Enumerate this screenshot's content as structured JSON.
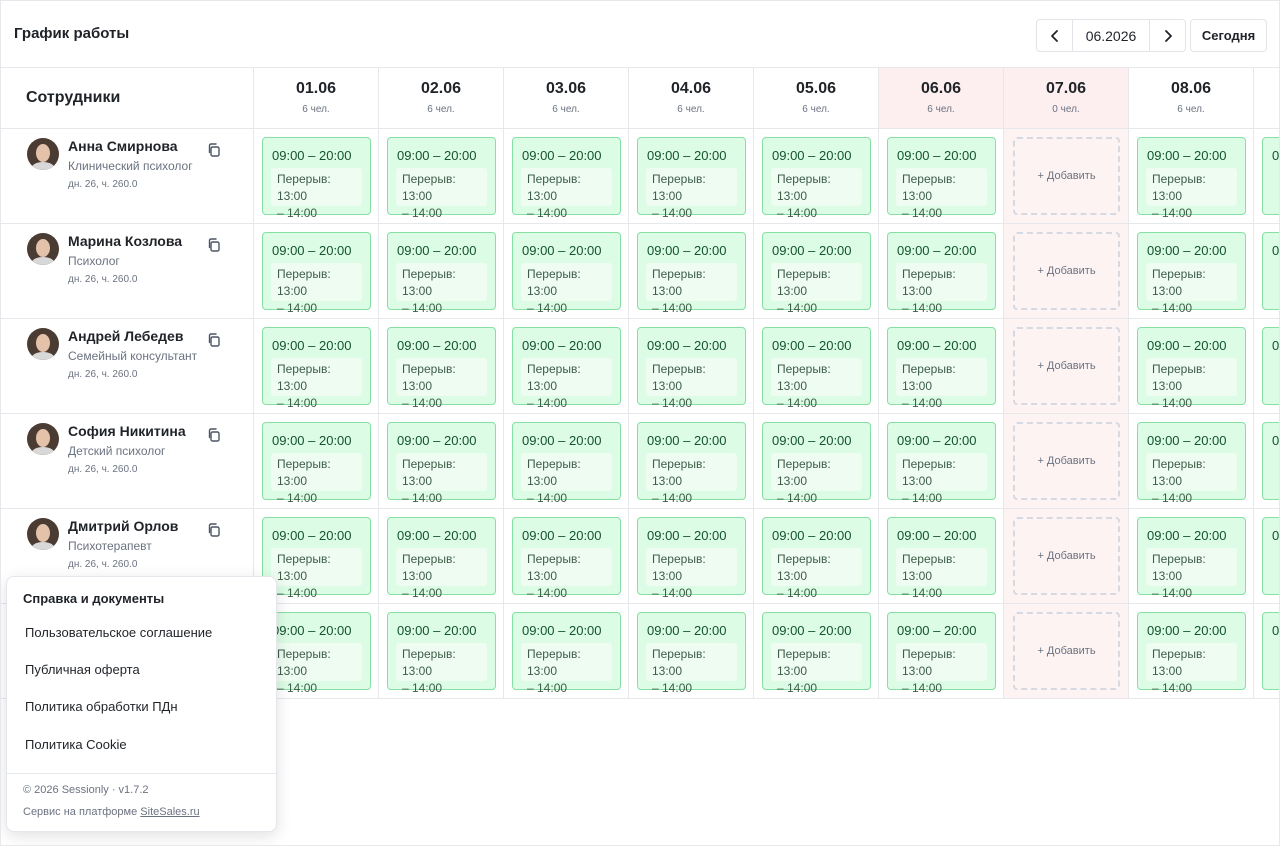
{
  "header": {
    "title": "График работы",
    "month": "06.2026",
    "today_label": "Сегодня"
  },
  "grid": {
    "employees_header": "Сотрудники",
    "days": [
      {
        "date": "01.06",
        "count": "6 чел.",
        "highlight": false
      },
      {
        "date": "02.06",
        "count": "6 чел.",
        "highlight": false
      },
      {
        "date": "03.06",
        "count": "6 чел.",
        "highlight": false
      },
      {
        "date": "04.06",
        "count": "6 чел.",
        "highlight": false
      },
      {
        "date": "05.06",
        "count": "6 чел.",
        "highlight": false
      },
      {
        "date": "06.06",
        "count": "6 чел.",
        "highlight": true
      },
      {
        "date": "07.06",
        "count": "0 чел.",
        "highlight": true
      },
      {
        "date": "08.06",
        "count": "6 чел.",
        "highlight": false
      }
    ],
    "employees": [
      {
        "name": "Анна Смирнова",
        "role": "Клинический психолог",
        "hours": "дн. 26, ч. 260.0"
      },
      {
        "name": "Марина Козлова",
        "role": "Психолог",
        "hours": "дн. 26, ч. 260.0"
      },
      {
        "name": "Андрей Лебедев",
        "role": "Семейный консультант",
        "hours": "дн. 26, ч. 260.0"
      },
      {
        "name": "София Никитина",
        "role": "Детский психолог",
        "hours": "дн. 26, ч. 260.0"
      },
      {
        "name": "Дмитрий Орлов",
        "role": "Психотерапевт",
        "hours": "дн. 26, ч. 260.0"
      },
      {
        "name": "",
        "role": "",
        "hours": ""
      }
    ],
    "shift": {
      "time": "09:00 – 20:00",
      "break_line1": "Перерыв: 13:00",
      "break_line2": "– 14:00"
    },
    "add_label": "+ Добавить",
    "off_day_index": 6
  },
  "popover": {
    "title": "Справка и документы",
    "items": [
      "Пользовательское соглашение",
      "Публичная оферта",
      "Политика обработки ПДн",
      "Политика Cookie"
    ],
    "copyright": "© 2026 Sessionly · v1.7.2",
    "platform_prefix": "Сервис на платформе ",
    "platform_link": "SiteSales.ru"
  },
  "colors": {
    "shift_bg": "#dcfce5",
    "shift_border": "#86e0a3",
    "highlight_bg": "#fdeff0"
  }
}
